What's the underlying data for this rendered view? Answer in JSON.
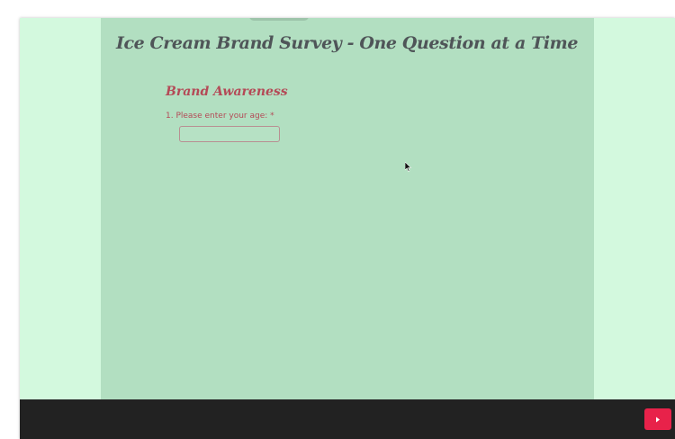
{
  "survey": {
    "title": "Ice Cream Brand Survey - One Question at a Time"
  },
  "section": {
    "heading": "Brand Awareness"
  },
  "question": {
    "label": "1. Please enter your age: ",
    "required_mark": "*",
    "value": ""
  },
  "footer": {
    "next_icon": "play-triangle-icon"
  },
  "colors": {
    "page_background": "#d3f9de",
    "panel_background": "#b2dfc1",
    "title_text": "#4f5558",
    "accent_text": "#b44a57",
    "footer_background": "#222222",
    "next_button": "#e8224a"
  }
}
